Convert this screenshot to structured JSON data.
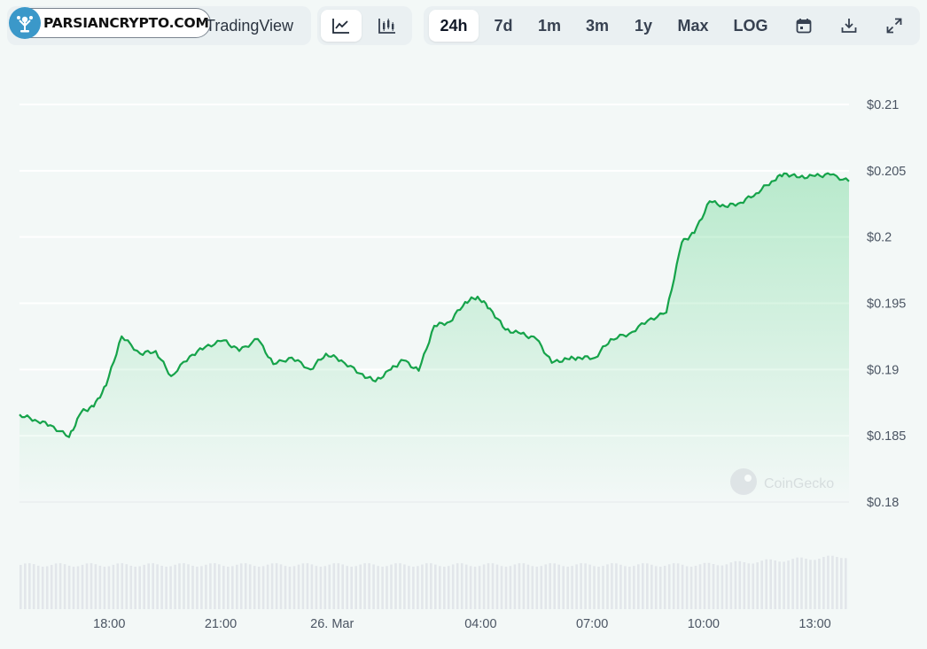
{
  "brand": {
    "label": "PARSIANCRYPTO.COM"
  },
  "toolbar": {
    "tradingview_label": "TradingView",
    "chart_types": [
      {
        "icon": "line-chart-icon",
        "active": true
      },
      {
        "icon": "candlestick-chart-icon",
        "active": false
      }
    ],
    "ranges": [
      "24h",
      "7d",
      "1m",
      "3m",
      "1y",
      "Max",
      "LOG"
    ],
    "active_range": "24h",
    "tools": [
      "calendar-icon",
      "download-icon",
      "fullscreen-icon"
    ]
  },
  "watermark": "CoinGecko",
  "colors": {
    "line": "#16a34a",
    "fill": "#22c55e",
    "volume": "#e2e6ea",
    "grid": "#ffffff"
  },
  "chart_data": {
    "type": "area",
    "ylim": [
      0.18,
      0.21
    ],
    "y_ticks": [
      0.21,
      0.205,
      0.2,
      0.195,
      0.19,
      0.185,
      0.18
    ],
    "y_tick_labels": [
      "$0.21",
      "$0.205",
      "$0.2",
      "$0.195",
      "$0.19",
      "$0.185",
      "$0.18"
    ],
    "xlim": [
      "2025-03-25T15:35",
      "2025-03-26T13:55"
    ],
    "x_ticks": [
      "2025-03-25T18:00",
      "2025-03-25T21:00",
      "2025-03-26T00:00",
      "2025-03-26T04:00",
      "2025-03-26T07:00",
      "2025-03-26T10:00",
      "2025-03-26T13:00"
    ],
    "x_tick_labels": [
      "18:00",
      "21:00",
      "26. Mar",
      "04:00",
      "07:00",
      "10:00",
      "13:00"
    ],
    "series": [
      {
        "x": [
          "2025-03-25T15:35",
          "2025-03-25T16:00",
          "2025-03-25T16:25",
          "2025-03-25T16:55",
          "2025-03-25T17:15",
          "2025-03-25T17:35",
          "2025-03-25T17:55",
          "2025-03-25T18:20",
          "2025-03-25T18:50",
          "2025-03-25T19:15",
          "2025-03-25T19:40",
          "2025-03-25T20:10",
          "2025-03-25T20:35",
          "2025-03-25T21:05",
          "2025-03-25T21:30",
          "2025-03-25T22:00",
          "2025-03-25T22:25",
          "2025-03-25T22:55",
          "2025-03-25T23:25",
          "2025-03-25T23:50",
          "2025-03-26T00:15",
          "2025-03-26T00:45",
          "2025-03-26T01:10",
          "2025-03-26T01:35",
          "2025-03-26T01:55",
          "2025-03-26T02:20",
          "2025-03-26T02:45",
          "2025-03-26T03:10",
          "2025-03-26T03:35",
          "2025-03-26T03:55",
          "2025-03-26T04:15",
          "2025-03-26T04:40",
          "2025-03-26T05:05",
          "2025-03-26T05:30",
          "2025-03-26T05:55",
          "2025-03-26T06:20",
          "2025-03-26T06:40",
          "2025-03-26T07:05",
          "2025-03-26T07:30",
          "2025-03-26T08:00",
          "2025-03-26T08:30",
          "2025-03-26T09:00",
          "2025-03-26T09:25",
          "2025-03-26T09:45",
          "2025-03-26T10:10",
          "2025-03-26T10:35",
          "2025-03-26T11:00",
          "2025-03-26T11:25",
          "2025-03-26T11:50",
          "2025-03-26T12:10",
          "2025-03-26T12:35",
          "2025-03-26T13:00",
          "2025-03-26T13:25",
          "2025-03-26T13:55"
        ],
        "y": [
          0.1866,
          0.1862,
          0.1858,
          0.1849,
          0.1868,
          0.1872,
          0.1888,
          0.1925,
          0.1912,
          0.1914,
          0.1895,
          0.191,
          0.1917,
          0.1922,
          0.1914,
          0.1923,
          0.1904,
          0.1909,
          0.19,
          0.1912,
          0.1907,
          0.1897,
          0.1891,
          0.19,
          0.1907,
          0.1899,
          0.1933,
          0.1936,
          0.1951,
          0.1955,
          0.1946,
          0.193,
          0.1927,
          0.1923,
          0.1905,
          0.1908,
          0.1909,
          0.1909,
          0.1923,
          0.1927,
          0.1937,
          0.1943,
          0.1996,
          0.2003,
          0.2027,
          0.2023,
          0.2026,
          0.2033,
          0.2042,
          0.2048,
          0.2045,
          0.2046,
          0.2047,
          0.2042
        ]
      }
    ]
  }
}
